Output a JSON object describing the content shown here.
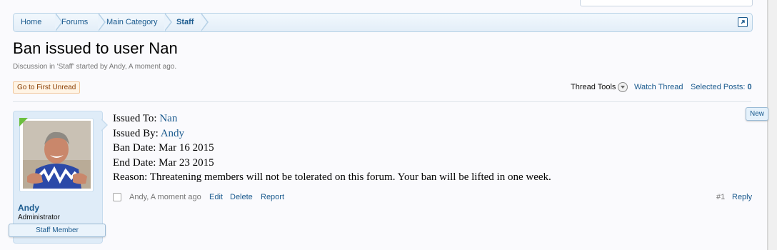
{
  "breadcrumb": [
    {
      "label": "Home"
    },
    {
      "label": "Forums"
    },
    {
      "label": "Main Category"
    },
    {
      "label": "Staff"
    }
  ],
  "thread": {
    "title": "Ban issued to user Nan",
    "meta": "Discussion in 'Staff' started by Andy, A moment ago."
  },
  "controls": {
    "first_unread": "Go to First Unread",
    "thread_tools": "Thread Tools",
    "watch_thread": "Watch Thread",
    "selected_posts_label": "Selected Posts:",
    "selected_posts_count": "0"
  },
  "post": {
    "new_tag": "New",
    "author": {
      "name": "Andy",
      "title": "Administrator",
      "badge": "Staff Member"
    },
    "body": {
      "issued_to_label": "Issued To:",
      "issued_to_value": "Nan",
      "issued_by_label": "Issued By:",
      "issued_by_value": "Andy",
      "ban_date": "Ban Date: Mar 16 2015",
      "end_date": "End Date: Mar 23 2015",
      "reason": "Reason: Threatening members will not be tolerated on this forum. Your ban will be lifted in one week."
    },
    "footer": {
      "author_time": "Andy, A moment ago",
      "edit": "Edit",
      "delete": "Delete",
      "report": "Report",
      "post_number": "#1",
      "reply": "Reply"
    }
  },
  "colors": {
    "link": "#1a5a8e",
    "breadcrumb_border": "#b6d1e6",
    "user_panel_bg": "#dfecf8",
    "new_marker": "#6bbf3e",
    "first_unread_bg": "#fff4e5"
  }
}
